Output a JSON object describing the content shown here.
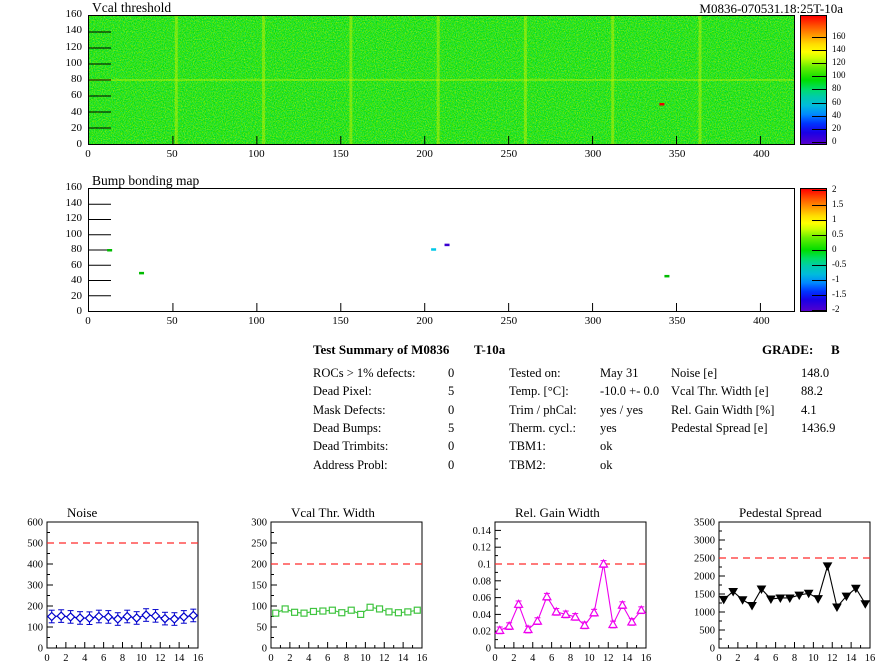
{
  "page": {
    "background": "#ffffff",
    "accent_red": "#ff2a2a"
  },
  "summary": {
    "title": "Test Summary of M0836",
    "test_label": "T-10a",
    "grade_label": "GRADE:",
    "grade_value": "B",
    "defects": [
      {
        "label": "ROCs > 1% defects:",
        "value": "0"
      },
      {
        "label": "Dead Pixel:",
        "value": "5"
      },
      {
        "label": "Mask Defects:",
        "value": "0"
      },
      {
        "label": "Dead Bumps:",
        "value": "5"
      },
      {
        "label": "Dead Trimbits:",
        "value": "0"
      },
      {
        "label": "Address Probl:",
        "value": "0"
      }
    ],
    "conditions": [
      {
        "label": "Tested on:",
        "value": "May 31"
      },
      {
        "label": "Temp. [°C]:",
        "value": "-10.0 +- 0.0"
      },
      {
        "label": "Trim / phCal:",
        "value": "yes / yes"
      },
      {
        "label": "Therm. cycl.:",
        "value": "yes"
      },
      {
        "label": "TBM1:",
        "value": "ok"
      },
      {
        "label": "TBM2:",
        "value": "ok"
      }
    ],
    "results": [
      {
        "label": "Noise [e]",
        "value": "148.0"
      },
      {
        "label": "Vcal Thr. Width [e]",
        "value": "88.2"
      },
      {
        "label": "Rel. Gain Width [%]",
        "value": "4.1"
      },
      {
        "label": "Pedestal Spread [e]",
        "value": "1436.9"
      }
    ]
  },
  "chart_data": [
    {
      "type": "heatmap",
      "title": "Vcal threshold",
      "right_title": "M0836-070531.18:25T-10a",
      "xlim": [
        0,
        420
      ],
      "ylim": [
        0,
        160
      ],
      "zlim": [
        0,
        160
      ],
      "x_ticks": [
        0,
        50,
        100,
        150,
        200,
        250,
        300,
        350,
        400
      ],
      "y_ticks": [
        0,
        20,
        40,
        60,
        80,
        100,
        120,
        140,
        160
      ],
      "colorbar_ticks": [
        160,
        140,
        120,
        100,
        80,
        60,
        40,
        20,
        0
      ],
      "palette": [
        "#ff0000",
        "#ff8800",
        "#ffff00",
        "#aaff00",
        "#00dd00",
        "#00ccaa",
        "#00aaff",
        "#0033ff",
        "#5500cc"
      ],
      "base_value_note": "uniform noisy map near 80 (green)",
      "base_color": "#05dc05",
      "seams_x": [
        52,
        104,
        156,
        208,
        260,
        312,
        364
      ],
      "band_y": 80,
      "points": [
        {
          "x": 341,
          "y": 50,
          "color": "#ee0000"
        }
      ]
    },
    {
      "type": "heatmap",
      "title": "Bump bonding map",
      "xlim": [
        0,
        420
      ],
      "ylim": [
        0,
        160
      ],
      "zlim": [
        -2,
        2
      ],
      "x_ticks": [
        0,
        50,
        100,
        150,
        200,
        250,
        300,
        350,
        400
      ],
      "y_ticks": [
        0,
        20,
        40,
        60,
        80,
        100,
        120,
        140,
        160
      ],
      "colorbar_ticks": [
        2,
        1.5,
        1,
        0.5,
        0,
        -0.5,
        -1,
        -1.5,
        -2
      ],
      "palette": [
        "#ff0000",
        "#ff8800",
        "#ffff00",
        "#aaff00",
        "#00dd00",
        "#00ccaa",
        "#00aaff",
        "#0033ff",
        "#5500cc"
      ],
      "base_color": "#ffffff",
      "points": [
        {
          "x": 12,
          "y": 80,
          "color": "#00bb00"
        },
        {
          "x": 31,
          "y": 50,
          "color": "#00bb00"
        },
        {
          "x": 205,
          "y": 81,
          "color": "#00c8e8"
        },
        {
          "x": 213,
          "y": 87,
          "color": "#3a00d0"
        },
        {
          "x": 344,
          "y": 46,
          "color": "#00bb00"
        }
      ]
    },
    {
      "type": "line",
      "title": "Noise",
      "x": [
        0.5,
        1.5,
        2.5,
        3.5,
        4.5,
        5.5,
        6.5,
        7.5,
        8.5,
        9.5,
        10.5,
        11.5,
        12.5,
        13.5,
        14.5,
        15.5
      ],
      "values": [
        150,
        152,
        148,
        143,
        142,
        150,
        148,
        138,
        150,
        143,
        157,
        153,
        140,
        138,
        148,
        155
      ],
      "xlim": [
        0,
        16
      ],
      "ylim": [
        0,
        600
      ],
      "x_ticks": [
        0,
        2,
        4,
        6,
        8,
        10,
        12,
        14,
        16
      ],
      "y_ticks": [
        "0",
        "100",
        "200",
        "300",
        "400",
        "500",
        "600"
      ],
      "cut_line": {
        "y": 500,
        "color": "#ff2a2a",
        "style": "dashed"
      },
      "marker": "diamond-open",
      "color": "#0000cc",
      "error": 30
    },
    {
      "type": "line",
      "title": "Vcal Thr. Width",
      "x": [
        0.5,
        1.5,
        2.5,
        3.5,
        4.5,
        5.5,
        6.5,
        7.5,
        8.5,
        9.5,
        10.5,
        11.5,
        12.5,
        13.5,
        14.5,
        15.5
      ],
      "values": [
        83,
        93,
        85,
        83,
        87,
        88,
        90,
        84,
        90,
        80,
        97,
        93,
        86,
        84,
        86,
        90
      ],
      "xlim": [
        0,
        16
      ],
      "ylim": [
        0,
        300
      ],
      "x_ticks": [
        0,
        2,
        4,
        6,
        8,
        10,
        12,
        14,
        16
      ],
      "y_ticks": [
        "0",
        "50",
        "100",
        "150",
        "200",
        "250",
        "300"
      ],
      "cut_line": {
        "y": 200,
        "color": "#ff2a2a",
        "style": "dashed"
      },
      "marker": "square-open",
      "color": "#3fc43f",
      "error": 0
    },
    {
      "type": "line",
      "title": "Rel. Gain Width",
      "x": [
        0.5,
        1.5,
        2.5,
        3.5,
        4.5,
        5.5,
        6.5,
        7.5,
        8.5,
        9.5,
        10.5,
        11.5,
        12.5,
        13.5,
        14.5,
        15.5
      ],
      "values": [
        0.021,
        0.026,
        0.052,
        0.022,
        0.032,
        0.061,
        0.043,
        0.04,
        0.037,
        0.027,
        0.042,
        0.1,
        0.028,
        0.051,
        0.031,
        0.045
      ],
      "xlim": [
        0,
        16
      ],
      "ylim": [
        0,
        0.15
      ],
      "x_ticks": [
        0,
        2,
        4,
        6,
        8,
        10,
        12,
        14,
        16
      ],
      "y_ticks": [
        "0",
        "0.02",
        "0.04",
        "0.06",
        "0.08",
        "0.1",
        "0.12",
        "0.14"
      ],
      "cut_line": {
        "y": 0.1,
        "color": "#ff2a2a",
        "style": "dashed"
      },
      "marker": "triangle-open",
      "color": "#ee00ee",
      "error": 0.004
    },
    {
      "type": "line",
      "title": "Pedestal Spread",
      "x": [
        0.5,
        1.5,
        2.5,
        3.5,
        4.5,
        5.5,
        6.5,
        7.5,
        8.5,
        9.5,
        10.5,
        11.5,
        12.5,
        13.5,
        14.5,
        15.5
      ],
      "values": [
        1350,
        1570,
        1340,
        1180,
        1640,
        1360,
        1390,
        1390,
        1470,
        1520,
        1370,
        2280,
        1140,
        1440,
        1660,
        1230
      ],
      "xlim": [
        0,
        16
      ],
      "ylim": [
        0,
        3500
      ],
      "x_ticks": [
        0,
        2,
        4,
        6,
        8,
        10,
        12,
        14,
        16
      ],
      "y_ticks": [
        "0",
        "500",
        "1000",
        "1500",
        "2000",
        "2500",
        "3000",
        "3500"
      ],
      "cut_line": {
        "y": 2500,
        "color": "#ff2a2a",
        "style": "dashed"
      },
      "marker": "triangle-down-filled",
      "color": "#000000",
      "error": 0
    }
  ]
}
